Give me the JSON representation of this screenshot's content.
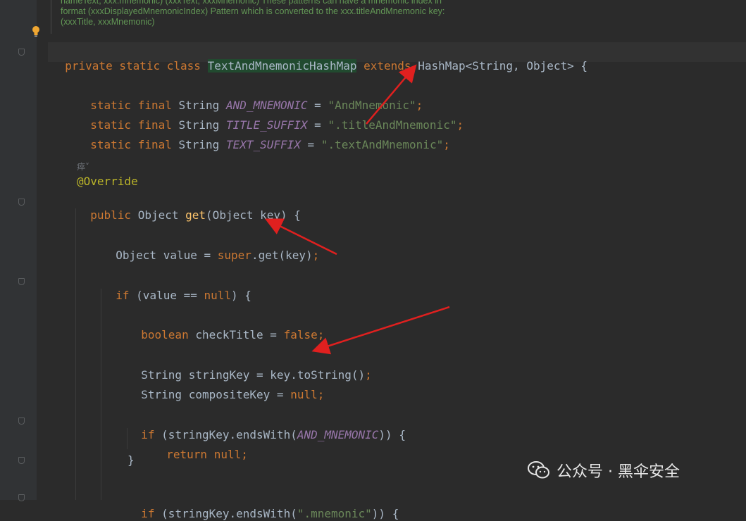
{
  "doc_comment": [
    "nameText, xxx.mnemonic) (xxxText, xxxMnemonic) These patterns can have a mnemonic index in",
    "format (xxxDisplayedMnemonicIndex) Pattern which is converted to the xxx.titleAndMnemonic key:",
    "(xxxTitle, xxxMnemonic)"
  ],
  "code": {
    "class_decl": {
      "mods": "private static class ",
      "name": "TextAndMnemonicHashMap",
      "extends_kw": " extends ",
      "parent": "HashMap<String, Object> {"
    },
    "c1": {
      "mods": "static final ",
      "type": "String ",
      "const": "AND_MNEMONIC",
      "eq": " = ",
      "str": "\"AndMnemonic\"",
      "end": ";"
    },
    "c2": {
      "mods": "static final ",
      "type": "String ",
      "const": "TITLE_SUFFIX",
      "eq": " = ",
      "str": "\".titleAndMnemonic\"",
      "end": ";"
    },
    "c3": {
      "mods": "static final ",
      "type": "String ",
      "const": "TEXT_SUFFIX",
      "eq": " = ",
      "str": "\".textAndMnemonic\"",
      "end": ";"
    },
    "inlay_hint": "瘁˅",
    "annotation": "@Override",
    "method_decl": {
      "mods": "public ",
      "rest1": "Object ",
      "name": "get",
      "rest2": "(Object key) {"
    },
    "l_value": {
      "a": "Object value = ",
      "kw": "super",
      "b": ".get(key)",
      "end": ";"
    },
    "l_if1": {
      "kw": "if ",
      "a": "(value == ",
      "null": "null",
      "b": ") {"
    },
    "l_bool": {
      "kw": "boolean ",
      "a": "checkTitle = ",
      "val": "false",
      "end": ";"
    },
    "l_strkey": {
      "a": "String stringKey = key.toString()",
      "end": ";"
    },
    "l_comp": {
      "a": "String compositeKey = ",
      "null": "null",
      "end": ";"
    },
    "l_if2": {
      "kw": "if ",
      "a": "(stringKey.endsWith(",
      "const": "AND_MNEMONIC",
      "b": ")) {"
    },
    "l_ret": {
      "kw": "return ",
      "null": "null",
      "end": ";"
    },
    "l_close": "}",
    "l_if3": {
      "kw": "if ",
      "a": "(stringKey.endsWith(",
      "str": "\".mnemonic\"",
      "b": ")) {"
    }
  },
  "watermark": {
    "text": "公众号 · 黑伞安全",
    "icon": "wechat-icon"
  },
  "colors": {
    "background": "#2b2b2b",
    "keyword": "#cc7832",
    "string": "#6a8759",
    "constant": "#9876aa",
    "annotation": "#bbb529",
    "method": "#ffc66d",
    "arrow": "#e0201f"
  }
}
